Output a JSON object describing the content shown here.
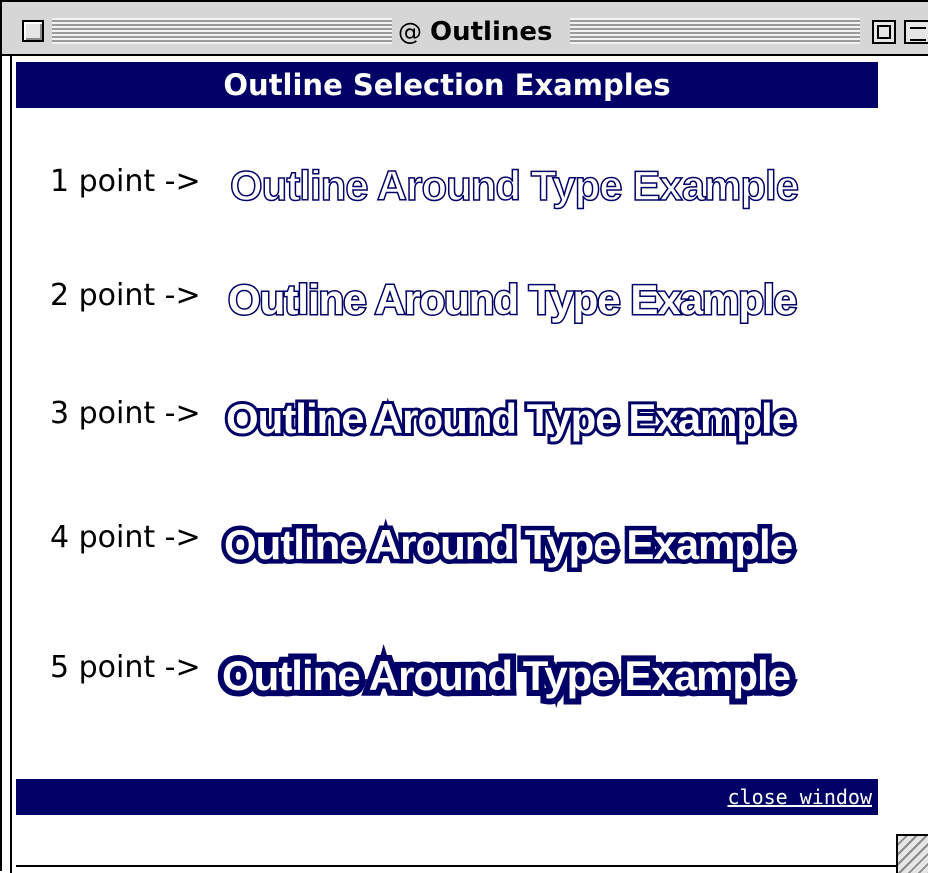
{
  "window": {
    "title": "Outlines",
    "title_icon": "@"
  },
  "banner": {
    "title": "Outline Selection Examples"
  },
  "examples": [
    {
      "label": "1 point ->",
      "text": "Outline Around Type Example"
    },
    {
      "label": "2 point ->",
      "text": "Outline Around Type Example"
    },
    {
      "label": "3 point ->",
      "text": "Outline Around Type Example"
    },
    {
      "label": "4 point ->",
      "text": "Outline Around Type Example"
    },
    {
      "label": "5 point ->",
      "text": "Outline Around Type Example"
    }
  ],
  "footer": {
    "close_link": "close window"
  },
  "colors": {
    "banner_bg": "#000066",
    "outline": "#000066",
    "titlebar": "#d6d6d6"
  },
  "icons": {
    "close_box": "close-box-icon",
    "zoom_box": "zoom-box-icon",
    "collapse_box": "collapse-box-icon",
    "resize": "resize-grip-icon"
  }
}
